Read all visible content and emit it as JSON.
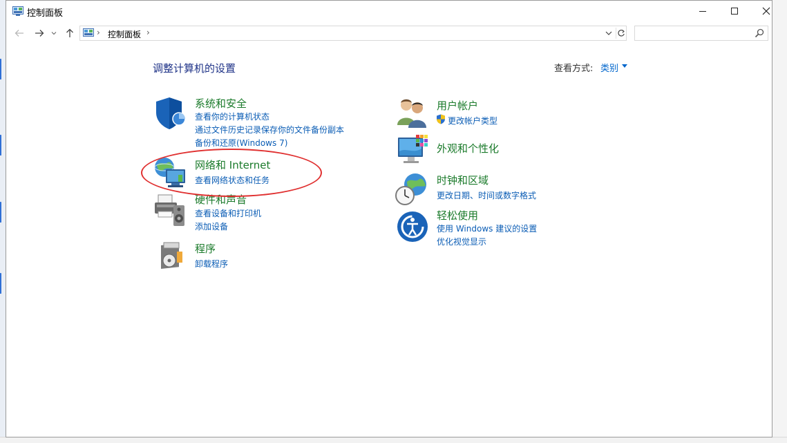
{
  "window": {
    "title": "控制面板",
    "controls": {
      "minimize": "minimize-icon",
      "maximize": "maximize-icon",
      "close": "close-icon"
    }
  },
  "nav": {
    "breadcrumb": [
      "控制面板"
    ],
    "search_placeholder": ""
  },
  "content": {
    "page_title": "调整计算机的设置",
    "view_by_label": "查看方式:",
    "view_by_value": "类别",
    "categories_left": [
      {
        "title": "系统和安全",
        "links": [
          "查看你的计算机状态",
          "通过文件历史记录保存你的文件备份副本",
          "备份和还原(Windows 7)"
        ],
        "icon": "shield-icon"
      },
      {
        "title": "网络和 Internet",
        "links": [
          "查看网络状态和任务"
        ],
        "icon": "network-globe-icon"
      },
      {
        "title": "硬件和声音",
        "links": [
          "查看设备和打印机",
          "添加设备"
        ],
        "icon": "printer-speaker-icon"
      },
      {
        "title": "程序",
        "links": [
          "卸载程序"
        ],
        "icon": "programs-disc-icon"
      }
    ],
    "categories_right": [
      {
        "title": "用户帐户",
        "links": [
          "更改帐户类型"
        ],
        "icon": "users-icon"
      },
      {
        "title": "外观和个性化",
        "links": [],
        "icon": "monitor-palette-icon"
      },
      {
        "title": "时钟和区域",
        "links": [
          "更改日期、时间或数字格式"
        ],
        "icon": "clock-globe-icon"
      },
      {
        "title": "轻松使用",
        "links": [
          "使用 Windows 建议的设置",
          "优化视觉显示"
        ],
        "icon": "ease-of-access-icon"
      }
    ]
  },
  "colors": {
    "title_green": "#1a7a2a",
    "link_blue": "#0b5db5",
    "heading_blue": "#1e3287",
    "annotation_red": "#e03030"
  }
}
